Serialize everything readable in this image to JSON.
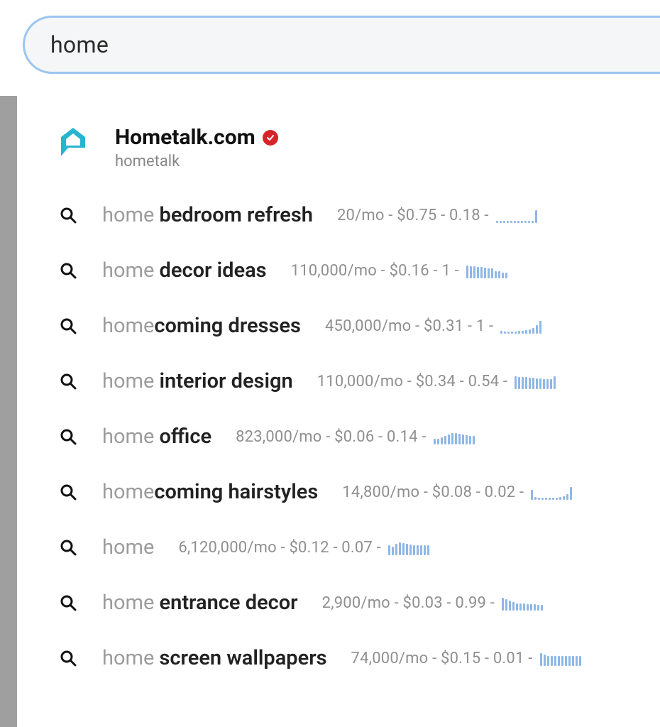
{
  "search": {
    "value": "home"
  },
  "site": {
    "title": "Hometalk.com",
    "subtitle": "hometalk"
  },
  "suggestions": [
    {
      "prefix": "home ",
      "bold": "bedroom refresh",
      "volume": "20/mo",
      "cpc": "$0.75",
      "comp": "0.18",
      "spark": [
        3,
        3,
        3,
        3,
        3,
        3,
        3,
        3,
        3,
        3,
        3,
        18
      ]
    },
    {
      "prefix": "home ",
      "bold": "decor ideas",
      "volume": "110,000/mo",
      "cpc": "$0.16",
      "comp": "1",
      "spark": [
        18,
        17,
        17,
        16,
        16,
        15,
        14,
        14,
        10,
        10,
        8,
        8
      ]
    },
    {
      "prefix": "home",
      "bold": "coming dresses",
      "volume": "450,000/mo",
      "cpc": "$0.31",
      "comp": "1",
      "spark": [
        4,
        3,
        3,
        3,
        3,
        4,
        4,
        5,
        6,
        8,
        12,
        18
      ]
    },
    {
      "prefix": "home ",
      "bold": "interior design",
      "volume": "110,000/mo",
      "cpc": "$0.34",
      "comp": "0.54",
      "spark": [
        18,
        17,
        17,
        17,
        16,
        16,
        15,
        15,
        14,
        14,
        14,
        18
      ]
    },
    {
      "prefix": "home ",
      "bold": "office",
      "volume": "823,000/mo",
      "cpc": "$0.06",
      "comp": "0.14",
      "spark": [
        8,
        8,
        10,
        12,
        14,
        16,
        16,
        15,
        14,
        13,
        12,
        12
      ]
    },
    {
      "prefix": "home",
      "bold": "coming hairstyles",
      "volume": "14,800/mo",
      "cpc": "$0.08",
      "comp": "0.02",
      "spark": [
        14,
        4,
        3,
        3,
        3,
        3,
        3,
        3,
        4,
        5,
        8,
        18
      ]
    },
    {
      "prefix": "home",
      "bold": "",
      "volume": "6,120,000/mo",
      "cpc": "$0.12",
      "comp": "0.07",
      "spark": [
        14,
        12,
        16,
        18,
        17,
        16,
        15,
        14,
        14,
        14,
        14,
        14
      ]
    },
    {
      "prefix": "home ",
      "bold": "entrance decor",
      "volume": "2,900/mo",
      "cpc": "$0.03",
      "comp": "0.99",
      "spark": [
        18,
        16,
        14,
        12,
        10,
        10,
        10,
        9,
        9,
        9,
        8,
        8
      ]
    },
    {
      "prefix": "home ",
      "bold": "screen wallpapers",
      "volume": "74,000/mo",
      "cpc": "$0.15",
      "comp": "0.01",
      "spark": [
        18,
        16,
        14,
        14,
        14,
        14,
        14,
        14,
        14,
        14,
        14,
        14
      ]
    }
  ]
}
